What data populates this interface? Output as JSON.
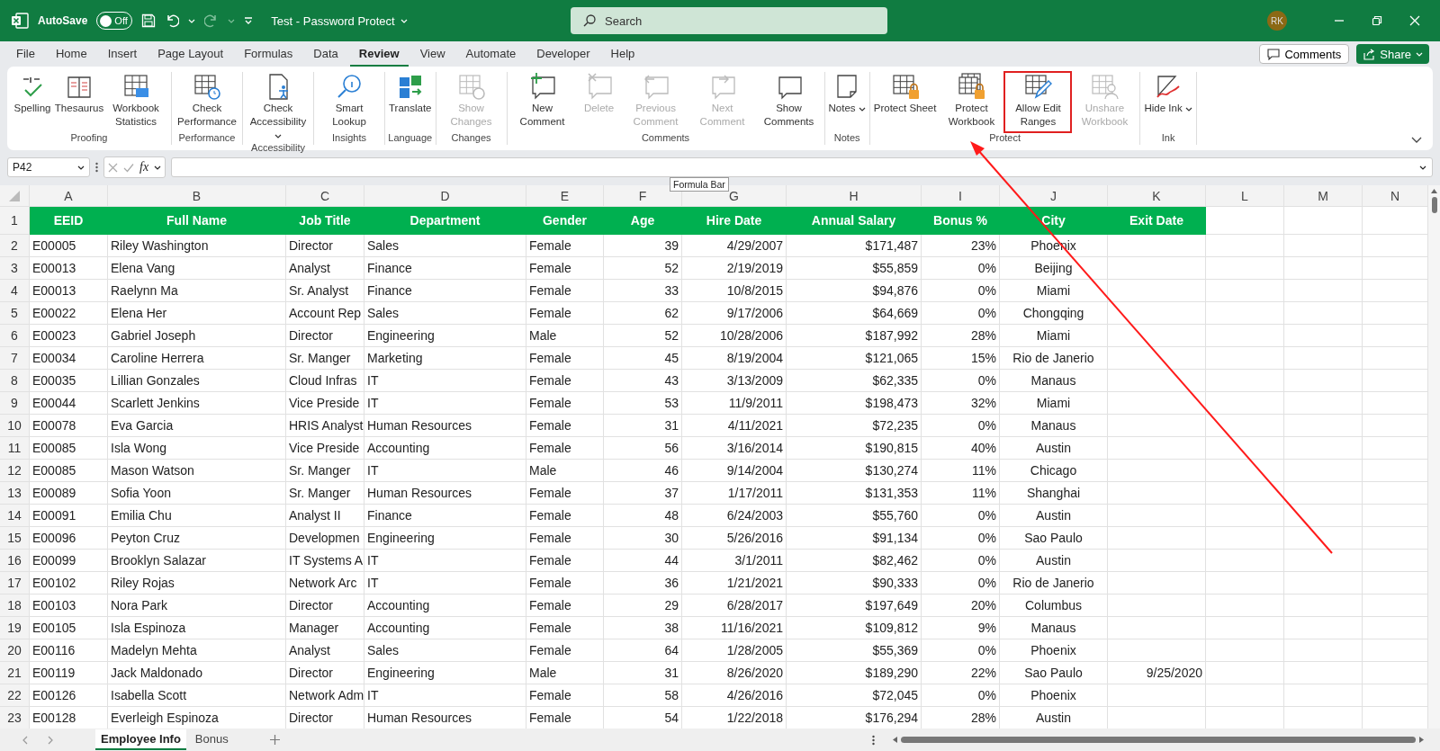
{
  "window": {
    "title": "Test - Password Protect",
    "autosave_label": "AutoSave",
    "autosave": {
      "on": false,
      "label": "Off"
    },
    "search": {
      "placeholder": "Search"
    },
    "avatar": "RK"
  },
  "menu_tabs": [
    {
      "label": "File",
      "selected": false
    },
    {
      "label": "Home",
      "selected": false
    },
    {
      "label": "Insert",
      "selected": false
    },
    {
      "label": "Page Layout",
      "selected": false
    },
    {
      "label": "Formulas",
      "selected": false
    },
    {
      "label": "Data",
      "selected": false
    },
    {
      "label": "Review",
      "selected": true
    },
    {
      "label": "View",
      "selected": false
    },
    {
      "label": "Automate",
      "selected": false
    },
    {
      "label": "Developer",
      "selected": false
    },
    {
      "label": "Help",
      "selected": false
    }
  ],
  "comments_button": "Comments",
  "share_button": "Share",
  "ribbon": [
    {
      "label": "Proofing",
      "buttons": [
        {
          "label": "Spelling",
          "disabled": false
        },
        {
          "label": "Thesaurus",
          "disabled": false
        },
        {
          "label": "Workbook Statistics",
          "disabled": false
        }
      ]
    },
    {
      "label": "Performance",
      "buttons": [
        {
          "label": "Check Performance",
          "disabled": false
        }
      ]
    },
    {
      "label": "Accessibility",
      "buttons": [
        {
          "label": "Check Accessibility",
          "disabled": false,
          "dropdown": true
        }
      ]
    },
    {
      "label": "Insights",
      "buttons": [
        {
          "label": "Smart Lookup",
          "disabled": false
        }
      ]
    },
    {
      "label": "Language",
      "buttons": [
        {
          "label": "Translate",
          "disabled": false
        }
      ]
    },
    {
      "label": "Changes",
      "buttons": [
        {
          "label": "Show Changes",
          "disabled": true
        }
      ]
    },
    {
      "label": "Comments",
      "buttons": [
        {
          "label": "New Comment",
          "disabled": false
        },
        {
          "label": "Delete",
          "disabled": true
        },
        {
          "label": "Previous Comment",
          "disabled": true
        },
        {
          "label": "Next Comment",
          "disabled": true
        },
        {
          "label": "Show Comments",
          "disabled": false
        }
      ]
    },
    {
      "label": "Notes",
      "buttons": [
        {
          "label": "Notes",
          "disabled": false,
          "dropdown": true
        }
      ]
    },
    {
      "label": "Protect",
      "buttons": [
        {
          "label": "Protect Sheet",
          "disabled": false
        },
        {
          "label": "Protect Workbook",
          "disabled": false
        },
        {
          "label": "Allow Edit Ranges",
          "disabled": false,
          "highlighted": true
        },
        {
          "label": "Unshare Workbook",
          "disabled": true
        }
      ]
    },
    {
      "label": "Ink",
      "buttons": [
        {
          "label": "Hide Ink",
          "disabled": false,
          "dropdown": true
        }
      ]
    }
  ],
  "formula_bar": {
    "name_box": "P42",
    "function_label": "fx",
    "tooltip": "Formula Bar"
  },
  "columns": [
    "A",
    "B",
    "C",
    "D",
    "E",
    "F",
    "G",
    "H",
    "I",
    "J",
    "K",
    "L",
    "M",
    "N"
  ],
  "header_row": {
    "num": "1",
    "cells": [
      "EEID",
      "Full Name",
      "Job Title",
      "Department",
      "Gender",
      "Age",
      "Hire Date",
      "Annual Salary",
      "Bonus %",
      "City",
      "Exit Date"
    ]
  },
  "rows": [
    {
      "num": "2",
      "cells": [
        "E00005",
        "Riley Washington",
        "Director",
        "Sales",
        "Female",
        "39",
        "4/29/2007",
        "$171,487",
        "23%",
        "Phoenix"
      ]
    },
    {
      "num": "3",
      "cells": [
        "E00013",
        "Elena Vang",
        "Analyst",
        "Finance",
        "Female",
        "52",
        "2/19/2019",
        "$55,859",
        "0%",
        "Beijing"
      ]
    },
    {
      "num": "4",
      "cells": [
        "E00013",
        "Raelynn Ma",
        "Sr. Analyst",
        "Finance",
        "Female",
        "33",
        "10/8/2015",
        "$94,876",
        "0%",
        "Miami"
      ]
    },
    {
      "num": "5",
      "cells": [
        "E00022",
        "Elena Her",
        "Account Rep",
        "Sales",
        "Female",
        "62",
        "9/17/2006",
        "$64,669",
        "0%",
        "Chongqing"
      ]
    },
    {
      "num": "6",
      "cells": [
        "E00023",
        "Gabriel Joseph",
        "Director",
        "Engineering",
        "Male",
        "52",
        "10/28/2006",
        "$187,992",
        "28%",
        "Miami"
      ]
    },
    {
      "num": "7",
      "cells": [
        "E00034",
        "Caroline Herrera",
        "Sr. Manger",
        "Marketing",
        "Female",
        "45",
        "8/19/2004",
        "$121,065",
        "15%",
        "Rio de Janerio"
      ]
    },
    {
      "num": "8",
      "cells": [
        "E00035",
        "Lillian Gonzales",
        "Cloud Infras",
        "IT",
        "Female",
        "43",
        "3/13/2009",
        "$62,335",
        "0%",
        "Manaus"
      ]
    },
    {
      "num": "9",
      "cells": [
        "E00044",
        "Scarlett Jenkins",
        "Vice Preside",
        "IT",
        "Female",
        "53",
        "11/9/2011",
        "$198,473",
        "32%",
        "Miami"
      ]
    },
    {
      "num": "10",
      "cells": [
        "E00078",
        "Eva Garcia",
        "HRIS Analyst",
        "Human Resources",
        "Female",
        "31",
        "4/11/2021",
        "$72,235",
        "0%",
        "Manaus"
      ]
    },
    {
      "num": "11",
      "cells": [
        "E00085",
        "Isla Wong",
        "Vice Preside",
        "Accounting",
        "Female",
        "56",
        "3/16/2014",
        "$190,815",
        "40%",
        "Austin"
      ]
    },
    {
      "num": "12",
      "cells": [
        "E00085",
        "Mason Watson",
        "Sr. Manger",
        "IT",
        "Male",
        "46",
        "9/14/2004",
        "$130,274",
        "11%",
        "Chicago"
      ]
    },
    {
      "num": "13",
      "cells": [
        "E00089",
        "Sofia Yoon",
        "Sr. Manger",
        "Human Resources",
        "Female",
        "37",
        "1/17/2011",
        "$131,353",
        "11%",
        "Shanghai"
      ]
    },
    {
      "num": "14",
      "cells": [
        "E00091",
        "Emilia Chu",
        "Analyst II",
        "Finance",
        "Female",
        "48",
        "6/24/2003",
        "$55,760",
        "0%",
        "Austin"
      ]
    },
    {
      "num": "15",
      "cells": [
        "E00096",
        "Peyton Cruz",
        "Developmen",
        "Engineering",
        "Female",
        "30",
        "5/26/2016",
        "$91,134",
        "0%",
        "Sao Paulo"
      ]
    },
    {
      "num": "16",
      "cells": [
        "E00099",
        "Brooklyn Salazar",
        "IT Systems A",
        "IT",
        "Female",
        "44",
        "3/1/2011",
        "$82,462",
        "0%",
        "Austin"
      ]
    },
    {
      "num": "17",
      "cells": [
        "E00102",
        "Riley Rojas",
        "Network Arc",
        "IT",
        "Female",
        "36",
        "1/21/2021",
        "$90,333",
        "0%",
        "Rio de Janerio"
      ]
    },
    {
      "num": "18",
      "cells": [
        "E00103",
        "Nora Park",
        "Director",
        "Accounting",
        "Female",
        "29",
        "6/28/2017",
        "$197,649",
        "20%",
        "Columbus"
      ]
    },
    {
      "num": "19",
      "cells": [
        "E00105",
        "Isla Espinoza",
        "Manager",
        "Accounting",
        "Female",
        "38",
        "11/16/2021",
        "$109,812",
        "9%",
        "Manaus"
      ]
    },
    {
      "num": "20",
      "cells": [
        "E00116",
        "Madelyn Mehta",
        "Analyst",
        "Sales",
        "Female",
        "64",
        "1/28/2005",
        "$55,369",
        "0%",
        "Phoenix"
      ]
    },
    {
      "num": "21",
      "cells": [
        "E00119",
        "Jack Maldonado",
        "Director",
        "Engineering",
        "Male",
        "31",
        "8/26/2020",
        "$189,290",
        "22%",
        "Sao Paulo"
      ],
      "exit_date": "9/25/2020"
    },
    {
      "num": "22",
      "cells": [
        "E00126",
        "Isabella Scott",
        "Network Adm",
        "IT",
        "Female",
        "58",
        "4/26/2016",
        "$72,045",
        "0%",
        "Phoenix"
      ]
    },
    {
      "num": "23",
      "cells": [
        "E00128",
        "Everleigh Espinoza",
        "Director",
        "Human Resources",
        "Female",
        "54",
        "1/22/2018",
        "$176,294",
        "28%",
        "Austin"
      ]
    }
  ],
  "sheet_tabs": [
    {
      "label": "Employee Info",
      "selected": true
    },
    {
      "label": "Bonus",
      "selected": false
    }
  ]
}
